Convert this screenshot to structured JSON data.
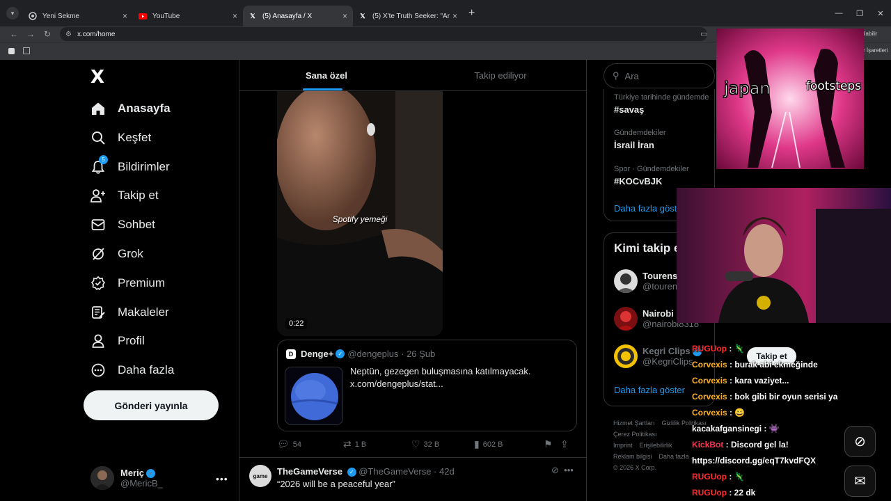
{
  "browser": {
    "tabs": [
      {
        "title": "Yeni Sekme",
        "active": false
      },
      {
        "title": "YouTube",
        "active": false
      },
      {
        "title": "(5) Anasayfa / X",
        "active": true
      },
      {
        "title": "(5) X'te Truth Seeker: \"Are you",
        "active": false
      }
    ],
    "url": "x.com/home",
    "addr_right": "ilabilir",
    "bookmarks_right": "r İşaretleri"
  },
  "sidebar": {
    "logo": "X",
    "items": [
      {
        "label": "Anasayfa",
        "icon": "home-icon"
      },
      {
        "label": "Keşfet",
        "icon": "search-icon"
      },
      {
        "label": "Bildirimler",
        "icon": "bell-icon",
        "badge": "5"
      },
      {
        "label": "Takip et",
        "icon": "follow-icon"
      },
      {
        "label": "Sohbet",
        "icon": "mail-icon"
      },
      {
        "label": "Grok",
        "icon": "grok-icon"
      },
      {
        "label": "Premium",
        "icon": "premium-icon"
      },
      {
        "label": "Makaleler",
        "icon": "articles-icon"
      },
      {
        "label": "Profil",
        "icon": "profile-icon"
      },
      {
        "label": "Daha fazla",
        "icon": "more-icon"
      }
    ],
    "post_button": "Gönderi yayınla",
    "account": {
      "name": "Meriç",
      "handle": "@MericB_",
      "more": "•••"
    }
  },
  "timeline": {
    "tabs": [
      "Sana özel",
      "Takip ediliyor"
    ],
    "video": {
      "caption": "Spotify yemeği",
      "duration": "0:22"
    },
    "quote": {
      "name": "Denge+",
      "meta": "@dengeplus · 26 Şub",
      "text": "Neptün, gezegen buluşmasına katılmayacak. x.com/dengeplus/stat..."
    },
    "actions": {
      "replies": "54",
      "reposts": "1 B",
      "likes": "32 B",
      "views": "602 B"
    },
    "tweet2": {
      "avatar_text": "game",
      "name": "TheGameVerse",
      "meta": "@TheGameVerse · 42d",
      "text": "“2026 will be a peaceful year”",
      "more": "•••"
    }
  },
  "right": {
    "search_placeholder": "Ara",
    "trends": [
      {
        "context": "Türkiye tarihinde gündemde",
        "title": "#savaş"
      },
      {
        "context": "Gündemdekiler",
        "title": "İsrail İran"
      },
      {
        "context": "Spor · Gündemdekiler",
        "title": "#KOCvBJK"
      }
    ],
    "trends_more": "Daha fazla göste",
    "wtf_title": "Kimi takip e",
    "wtf_users": [
      {
        "name": "Tourens",
        "handle": "@touren"
      },
      {
        "name": "Nairobi",
        "handle": "@nairobi8318"
      },
      {
        "name": "Kegri Clips",
        "handle": "@KegriClips"
      }
    ],
    "wtf_more": "Daha fazla göster",
    "follow_label": "Takip et",
    "footer": [
      "Hizmet Şartları",
      "Gizlilik Politikası",
      "Çerez Politikası",
      "Imprint",
      "Erişilebilirlik",
      "Reklam bilgisi",
      "Daha fazla ...",
      "© 2026 X Corp."
    ]
  },
  "overlay": {
    "meme": {
      "left": "japan",
      "right": "footsteps"
    },
    "chat": [
      {
        "user": "RUGUop",
        "msg": " : 🦎",
        "ucls": "u1"
      },
      {
        "user": "Corvexis",
        "msg": " : burak abi ekmeğinde",
        "ucls": "u2"
      },
      {
        "user": "Corvexis",
        "msg": " : kara vaziyet...",
        "ucls": "u2"
      },
      {
        "user": "Corvexis",
        "msg": " : bok gibi bir oyun serisi ya",
        "ucls": "u2"
      },
      {
        "user": "Corvexis",
        "msg": " : 😀",
        "ucls": "u2"
      },
      {
        "user": "kacakafgansinegi",
        "msg": " : 👾",
        "ucls": "msg"
      },
      {
        "user": "KickBot",
        "msg": " : Discord gel la!",
        "ucls": "u3"
      },
      {
        "user": "",
        "msg": "https://discord.gg/eqT7kvdFQX",
        "ucls": "msg"
      },
      {
        "user": "RUGUop",
        "msg": " : 🦎",
        "ucls": "u1"
      },
      {
        "user": "RUGUop",
        "msg": " : 22 dk",
        "ucls": "u1"
      }
    ]
  }
}
